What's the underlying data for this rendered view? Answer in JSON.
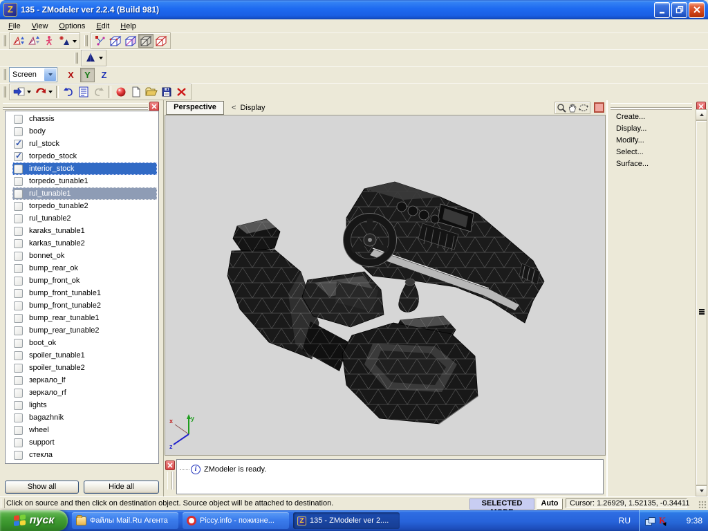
{
  "window": {
    "icon_letter": "Z",
    "title": "135 - ZModeler ver 2.2.4 (Build 981)"
  },
  "menubar": {
    "items": [
      "File",
      "View",
      "Options",
      "Edit",
      "Help"
    ]
  },
  "toolbar": {
    "screen_combo": "Screen",
    "axis_buttons": [
      "X",
      "Y",
      "Z"
    ]
  },
  "object_panel": {
    "items": [
      {
        "label": "chassis"
      },
      {
        "label": "body"
      },
      {
        "label": "rul_stock",
        "checked": true
      },
      {
        "label": "torpedo_stock",
        "checked": true
      },
      {
        "label": "interior_stock",
        "state": "selected"
      },
      {
        "label": "torpedo_tunable1"
      },
      {
        "label": "rul_tunable1",
        "state": "selected-inactive"
      },
      {
        "label": "torpedo_tunable2"
      },
      {
        "label": "rul_tunable2"
      },
      {
        "label": "karaks_tunable1"
      },
      {
        "label": "karkas_tunable2"
      },
      {
        "label": "bonnet_ok"
      },
      {
        "label": "bump_rear_ok"
      },
      {
        "label": "bump_front_ok"
      },
      {
        "label": "bump_front_tunable1"
      },
      {
        "label": "bump_front_tunable2"
      },
      {
        "label": "bump_rear_tunable1"
      },
      {
        "label": "bump_rear_tunable2"
      },
      {
        "label": "boot_ok"
      },
      {
        "label": "spoiler_tunable1"
      },
      {
        "label": "spoiler_tunable2"
      },
      {
        "label": "зеркало_lf"
      },
      {
        "label": "зеркало_rf"
      },
      {
        "label": "lights"
      },
      {
        "label": "bagazhnik"
      },
      {
        "label": "wheel"
      },
      {
        "label": "support"
      },
      {
        "label": "стекла"
      }
    ],
    "show_all": "Show all",
    "hide_all": "Hide all"
  },
  "viewport": {
    "mode": "Perspective",
    "back_arrow": "<",
    "breadcrumb": "Display",
    "axis": {
      "x": "x",
      "y": "y",
      "z": "z"
    }
  },
  "right_panel": {
    "items": [
      "Create...",
      "Display...",
      "Modify...",
      "Select...",
      "Surface..."
    ]
  },
  "log": {
    "message": "ZModeler is ready."
  },
  "statusbar": {
    "message": "Click on source and then click on destination object. Source object will be attached to destination.",
    "mode": "SELECTED MODE",
    "auto": "Auto",
    "cursor": "Cursor: 1.26929, 1.52135, -0.34411"
  },
  "taskbar": {
    "start": "пуск",
    "tasks": [
      {
        "label": "Файлы Mail.Ru Агента"
      },
      {
        "label": "Piccy.info - пожизне..."
      },
      {
        "label": "135 - ZModeler ver 2....",
        "active": true,
        "icon_letter": "Z"
      }
    ],
    "tray": {
      "language": "RU",
      "kaspersky_letter": "K",
      "time": "9:38"
    }
  }
}
